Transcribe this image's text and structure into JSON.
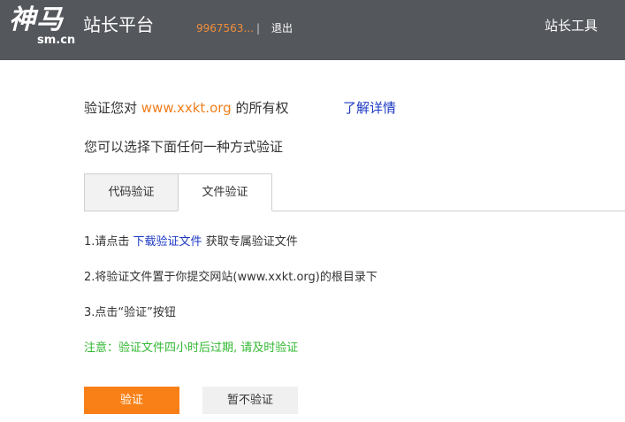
{
  "header": {
    "logo_text": "神马",
    "logo_sub": "sm.cn",
    "site_name": "站长平台",
    "user_id": "9967563...",
    "separator": "|",
    "logout_label": "退出",
    "tools_label": "站长工具"
  },
  "main": {
    "verify_prefix": "验证您对 ",
    "domain": "www.xxkt.org",
    "verify_suffix": " 的所有权",
    "learn_more_label": "了解详情",
    "choose_text": "您可以选择下面任何一种方式验证",
    "tabs": [
      {
        "label": "代码验证"
      },
      {
        "label": "文件验证"
      }
    ],
    "steps": {
      "step1_prefix": "1.请点击 ",
      "step1_link": "下载验证文件",
      "step1_suffix": " 获取专属验证文件",
      "step2": "2.将验证文件置于你提交网站(www.xxkt.org)的根目录下",
      "step3": "3.点击“验证”按钮"
    },
    "notice": "注意：验证文件四小时后过期, 请及时验证",
    "verify_button": "验证",
    "skip_button": "暂不验证"
  },
  "colors": {
    "header_bg": "#54575c",
    "accent_orange": "#f98016",
    "link_blue": "#1d39c4",
    "notice_green": "#33b833"
  }
}
